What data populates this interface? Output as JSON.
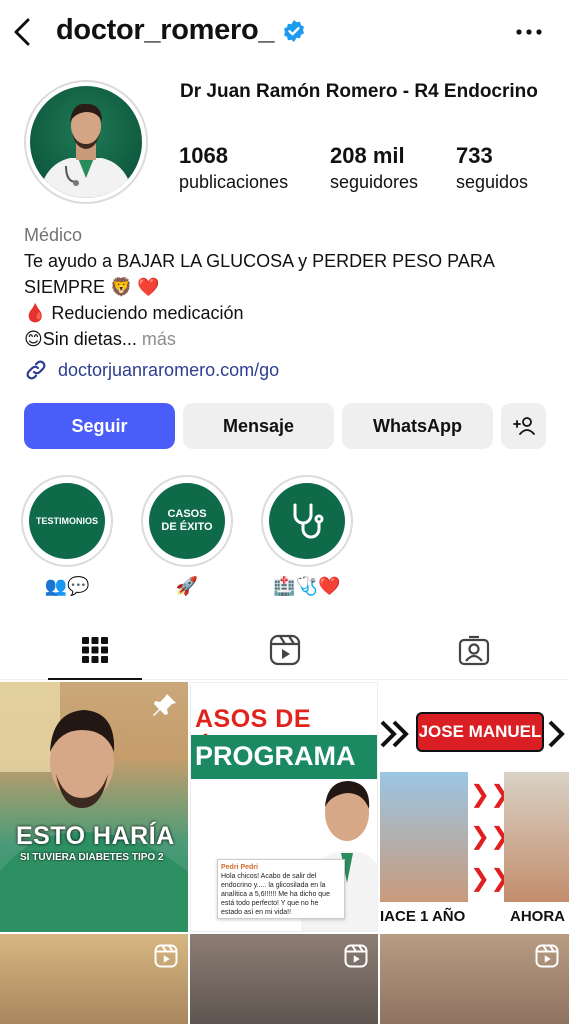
{
  "header": {
    "username": "doctor_romero_",
    "back_icon": "chevron-left-icon",
    "more_icon": "more-horizontal-icon",
    "verified_color": "#1d9bf0"
  },
  "profile": {
    "display_name": "Dr Juan Ramón Romero - R4 Endocrino",
    "stats": [
      {
        "value": "1068",
        "label": "publicaciones"
      },
      {
        "value": "208 mil",
        "label": "seguidores"
      },
      {
        "value": "733",
        "label": "seguidos"
      }
    ],
    "category": "Médico",
    "bio_line1": "Te ayudo a BAJAR LA GLUCOSA y PERDER PESO PARA SIEMPRE 🦁 ❤️",
    "bio_line2": "🩸 Reduciendo medicación",
    "bio_line3": "😊Sin dietas...",
    "bio_more": " más",
    "link": "doctorjuanraromero.com/go"
  },
  "buttons": {
    "follow": "Seguir",
    "message": "Mensaje",
    "whatsapp": "WhatsApp",
    "follow_color": "#4a5df9"
  },
  "highlights": [
    {
      "circle_text": "TESTIMONIOS",
      "label": "👥💬"
    },
    {
      "circle_text": "CASOS DE ÉXITO",
      "label": "🚀"
    },
    {
      "circle_text": "",
      "label": "🏥🩺❤️"
    }
  ],
  "tabs": [
    "grid-icon",
    "reels-icon",
    "tagged-icon"
  ],
  "posts": {
    "p1_title": "ESTO HARÍA",
    "p1_sub": "SI TUVIERA DIABETES TIPO 2",
    "p2_title": "ASOS DE ÉXITO",
    "p2_band": "PROGRAMA",
    "p2_chat_name": "Pedri Pedri",
    "p2_chat_text": "Hola chicos! Acabo de salir del endocrino y..... la glicosilada en la analítica a 5,6!!!!!! Me ha dicho que está todo perfecto! Y que no he estado así en mi vida!!",
    "p3_name": "JOSE MANUEL",
    "p3_before": "IACE 1 AÑO",
    "p3_after": "AHORA"
  }
}
